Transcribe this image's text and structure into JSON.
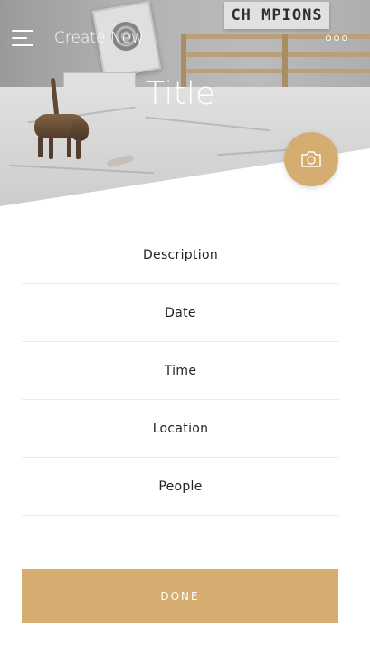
{
  "header": {
    "screen_title": "Create New",
    "menu_icon": "hamburger-menu-icon",
    "more_icon": "more-options-icon"
  },
  "hero": {
    "title": "Title",
    "sign_text": "CH MPIONS",
    "camera_icon": "camera-icon"
  },
  "fields": [
    {
      "label": "Description"
    },
    {
      "label": "Date"
    },
    {
      "label": "Time"
    },
    {
      "label": "Location"
    },
    {
      "label": "People"
    }
  ],
  "actions": {
    "done_label": "DONE"
  },
  "colors": {
    "accent": "#d5ad70",
    "divider": "#ececec",
    "text": "#222222",
    "background": "#ffffff"
  }
}
